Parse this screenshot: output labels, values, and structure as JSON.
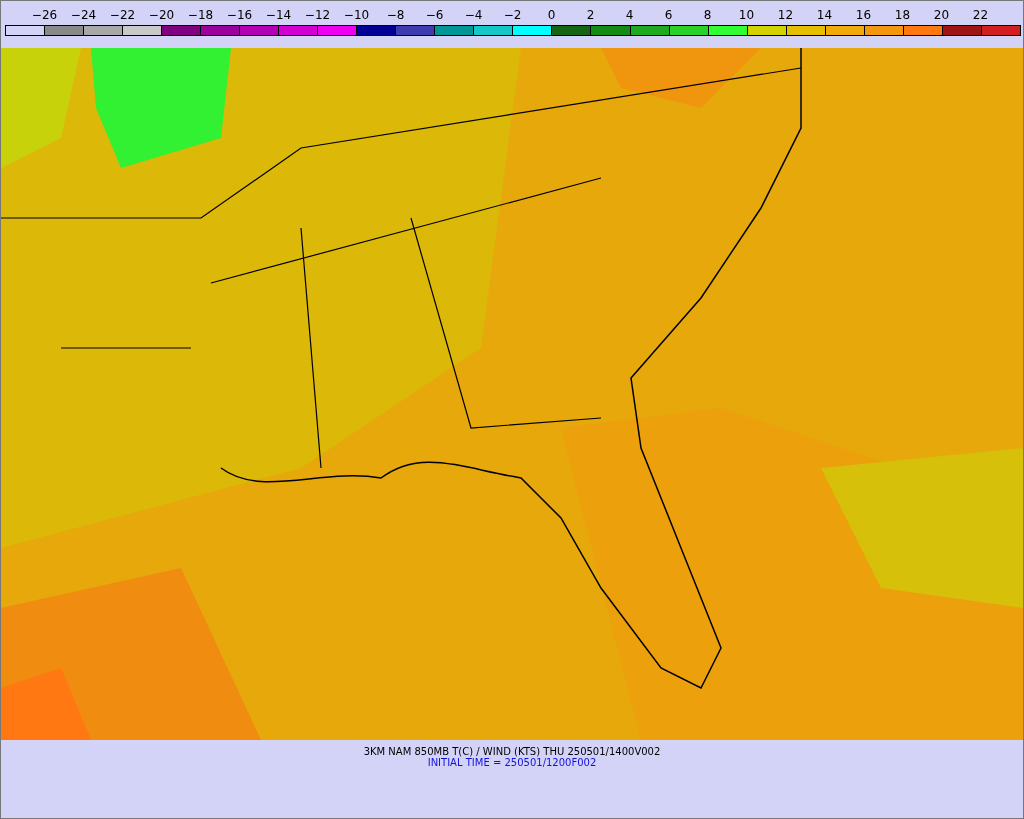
{
  "legend": {
    "ticks": [
      "−26",
      "−24",
      "−22",
      "−20",
      "−18",
      "−16",
      "−14",
      "−12",
      "−10",
      "−8",
      "−6",
      "−4",
      "−2",
      "0",
      "2",
      "4",
      "6",
      "8",
      "10",
      "12",
      "14",
      "16",
      "18",
      "20",
      "22"
    ],
    "swatches": [
      {
        "color": "#d3d3f8"
      },
      {
        "color": "#8a8a8a"
      },
      {
        "color": "#a8a8a8"
      },
      {
        "color": "#c8c8c8"
      },
      {
        "color": "#800080"
      },
      {
        "color": "#9c009c"
      },
      {
        "color": "#b400b4"
      },
      {
        "color": "#d200d2"
      },
      {
        "color": "#f000f0"
      },
      {
        "color": "#000096"
      },
      {
        "color": "#3c3caf"
      },
      {
        "color": "#009696"
      },
      {
        "color": "#14c8c8"
      },
      {
        "color": "#00ffff"
      },
      {
        "color": "#146414"
      },
      {
        "color": "#148c14"
      },
      {
        "color": "#1eaa1e"
      },
      {
        "color": "#28d228"
      },
      {
        "color": "#32ff32"
      },
      {
        "color": "#d2d200"
      },
      {
        "color": "#e6be00"
      },
      {
        "color": "#f0aa0a"
      },
      {
        "color": "#f5960f"
      },
      {
        "color": "#ff780f"
      },
      {
        "color": "#a01414"
      },
      {
        "color": "#d21e1e"
      }
    ]
  },
  "caption": {
    "title": "3KM NAM 850MB T(C) / WIND (KTS) THU 250501/1400V002",
    "initial_time": "INITIAL TIME = 250501/1200F002"
  }
}
